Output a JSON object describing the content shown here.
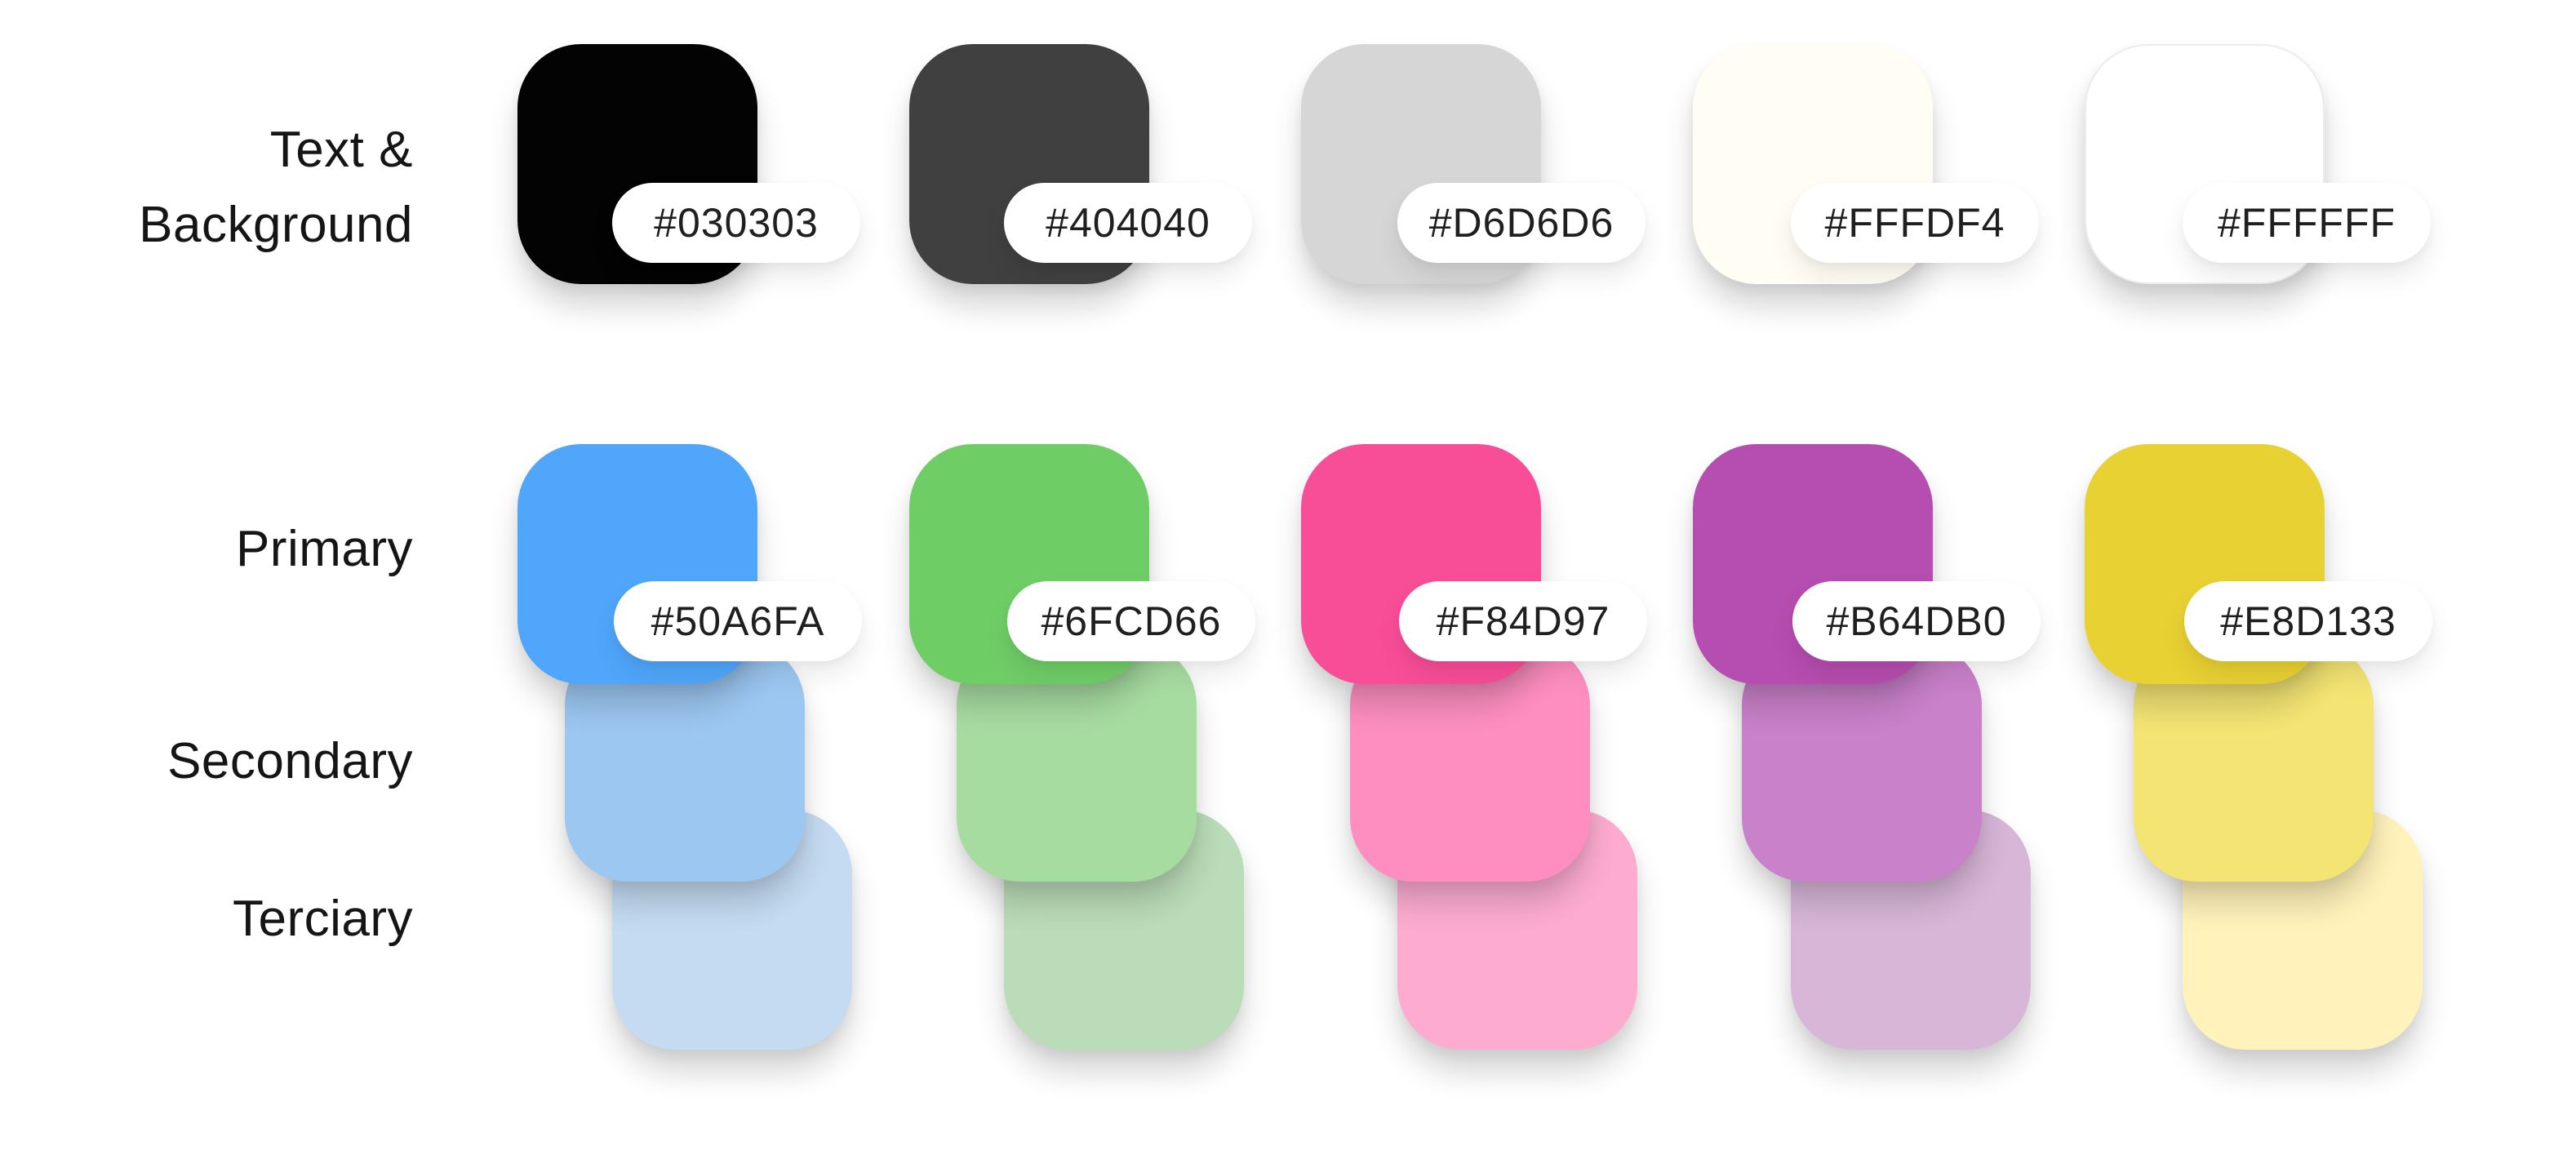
{
  "labels": {
    "text_background_line1": "Text &",
    "text_background_line2": "Background",
    "primary": "Primary",
    "secondary": "Secondary",
    "tertiary": "Terciary"
  },
  "neutral": [
    {
      "name": "black",
      "hex": "#030303",
      "fill": "#030303"
    },
    {
      "name": "dark-gray",
      "hex": "#404040",
      "fill": "#404040"
    },
    {
      "name": "light-gray",
      "hex": "#D6D6D6",
      "fill": "#D6D6D6"
    },
    {
      "name": "cream",
      "hex": "#FFFDF4",
      "fill": "#FFFDF4"
    },
    {
      "name": "white",
      "hex": "#FFFFFF",
      "fill": "#FFFFFF"
    }
  ],
  "palette": [
    {
      "name": "blue",
      "primary": {
        "hex": "#50A6FA",
        "fill": "#50A6FA"
      },
      "secondary_fill": "#9CC7F1",
      "tertiary_fill": "#C4DBF2"
    },
    {
      "name": "green",
      "primary": {
        "hex": "#6FCD66",
        "fill": "#6FCD66"
      },
      "secondary_fill": "#A7DCA1",
      "tertiary_fill": "#BADCB8"
    },
    {
      "name": "pink",
      "primary": {
        "hex": "#F84D97",
        "fill": "#F84D97"
      },
      "secondary_fill": "#FE8EC0",
      "tertiary_fill": "#FDACD0"
    },
    {
      "name": "purple",
      "primary": {
        "hex": "#B64DB0",
        "fill": "#B64DB0"
      },
      "secondary_fill": "#C981C9",
      "tertiary_fill": "#D7B6D7"
    },
    {
      "name": "yellow",
      "primary": {
        "hex": "#E8D133",
        "fill": "#E8D133"
      },
      "secondary_fill": "#F3E473",
      "tertiary_fill": "#FFF2BA"
    }
  ]
}
